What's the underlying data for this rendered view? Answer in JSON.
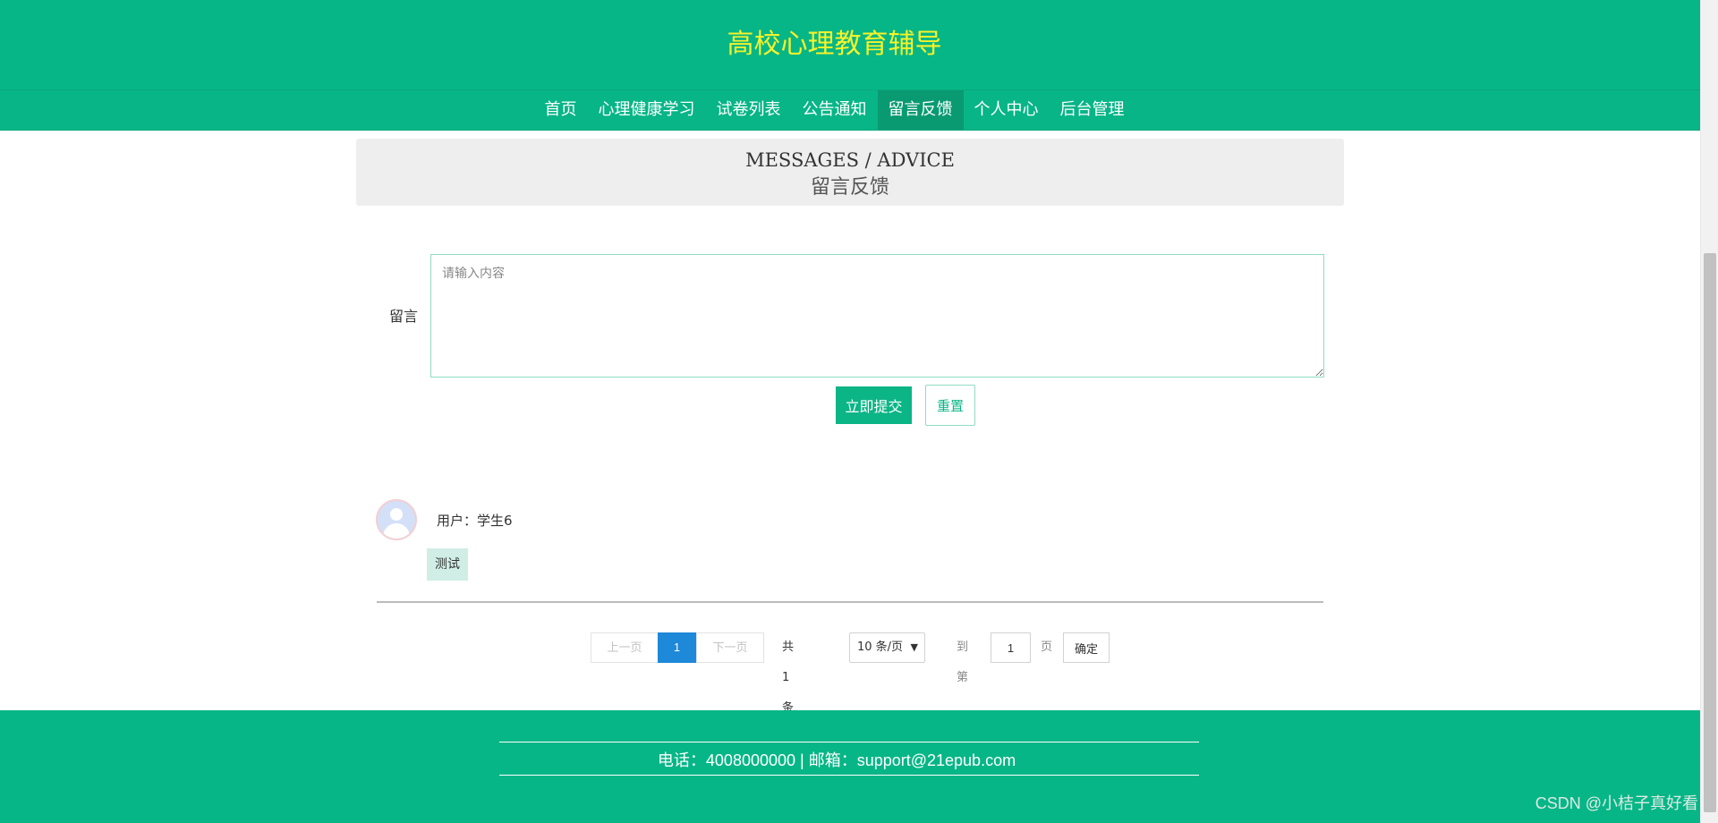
{
  "site": {
    "title": "高校心理教育辅导"
  },
  "nav": {
    "items": [
      {
        "label": "首页"
      },
      {
        "label": "心理健康学习"
      },
      {
        "label": "试卷列表"
      },
      {
        "label": "公告通知"
      },
      {
        "label": "留言反馈",
        "active": true
      },
      {
        "label": "个人中心"
      },
      {
        "label": "后台管理"
      }
    ]
  },
  "banner": {
    "title_en": "MESSAGES / ADVICE",
    "title_cn": "留言反馈"
  },
  "form": {
    "label": "留言",
    "placeholder": "请输入内容",
    "value": "",
    "submit_label": "立即提交",
    "reset_label": "重置"
  },
  "messages": [
    {
      "user": "用户：学生6",
      "content": "测试"
    }
  ],
  "pagination": {
    "prev_label": "上一页",
    "current_page": "1",
    "next_label": "下一页",
    "total_text": "共 1 条",
    "page_size": "10 条/页",
    "goto_label": "到第",
    "goto_value": "1",
    "page_word": "页",
    "confirm_label": "确定"
  },
  "footer": {
    "contact": "电话：4008000000 | 邮箱：support@21epub.com"
  },
  "watermark": "CSDN @小桔子真好看",
  "colors": {
    "primary": "#06b686",
    "title": "#f7f22a",
    "page_active": "#1e88d9"
  }
}
